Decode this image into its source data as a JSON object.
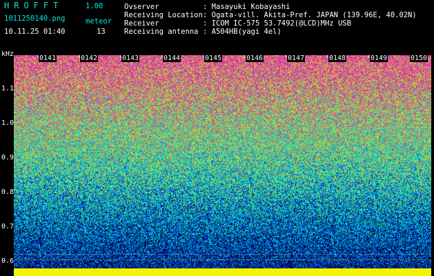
{
  "header": {
    "app_title": "HROFFT",
    "app_version": "1.00",
    "file_name": "1011250140.png",
    "datetime": "10.11.25 01:40",
    "meteor_label": "meteor",
    "meteor_count": "13",
    "info": [
      {
        "label": "Ovserver",
        "value": ": Masayuki Kobayashi"
      },
      {
        "label": "Receiving Location",
        "value": ": Ogata-vill. Akita-Pref. JAPAN (139.96E, 40.02N)"
      },
      {
        "label": "Receiver",
        "value": ": ICOM IC-575 53.7492(@LCD)MHz USB"
      },
      {
        "label": "Receiving antenna",
        "value": ": A504HB(yagi 4el)"
      }
    ]
  },
  "axis": {
    "unit": "kHz",
    "y_labels": [
      "1.1",
      "1.0",
      "0.9",
      "0.8",
      "0.7",
      "0.6"
    ],
    "time_labels": [
      "0141",
      "0142",
      "0143",
      "0144",
      "0145",
      "0146",
      "0147",
      "0148",
      "0149",
      "0150"
    ]
  },
  "colors": {
    "background": "#000000",
    "header_text": "#ffffff",
    "accent_text": "#00e8e8",
    "baseline_band": "#f4f400"
  }
}
